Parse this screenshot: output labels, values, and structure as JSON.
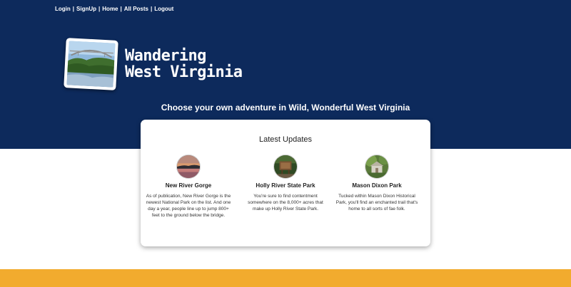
{
  "nav": {
    "items": [
      {
        "label": "Login"
      },
      {
        "label": "SignUp"
      },
      {
        "label": "Home"
      },
      {
        "label": "All Posts"
      },
      {
        "label": "Logout"
      }
    ],
    "separator": "|"
  },
  "brand": {
    "title_line1": "Wandering",
    "title_line2": "West Virginia",
    "logo_image_icon": "bridge-photo-icon"
  },
  "hero": {
    "tagline": "Choose your own adventure in Wild, Wonderful West Virginia"
  },
  "updates": {
    "heading": "Latest Updates",
    "items": [
      {
        "name": "New River Gorge",
        "description": "As of publication, New River Gorge is the newest National Park on the list. And one day a year, people line up to jump 800+ feet to the ground below the bridge.",
        "image_icon": "sunset-lake-icon"
      },
      {
        "name": "Holly River State Park",
        "description": "You're sure to find contentment somewhere on the 8,000+ acres that make up Holly River State Park.",
        "image_icon": "park-sign-icon"
      },
      {
        "name": "Mason Dixon Park",
        "description": "Tucked within Mason Dixon Historical Park, you'll find an enchanted trail that's home to all sorts of fae folk.",
        "image_icon": "fairy-house-icon"
      }
    ]
  },
  "colors": {
    "hero_bg": "#0d2a5c",
    "footer_bg": "#f2ab2e",
    "card_bg": "#ffffff"
  }
}
